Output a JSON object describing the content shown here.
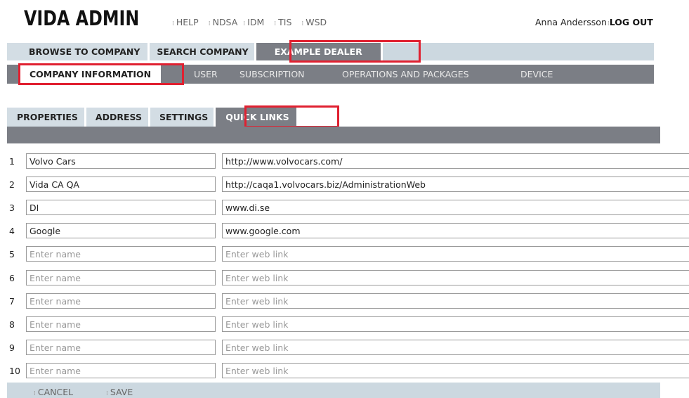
{
  "header": {
    "brand": "VIDA ADMIN",
    "links": [
      "HELP",
      "NDSA",
      "IDM",
      "TIS",
      "WSD"
    ],
    "user_name": "Anna Andersson",
    "logout": "LOG OUT"
  },
  "main_tabs": [
    "BROWSE TO COMPANY",
    "SEARCH COMPANY",
    "EXAMPLE DEALER"
  ],
  "sub_tabs": [
    "COMPANY INFORMATION",
    "USER",
    "SUBSCRIPTION",
    "OPERATIONS AND PACKAGES",
    "DEVICE"
  ],
  "inner_tabs": [
    "PROPERTIES",
    "ADDRESS",
    "SETTINGS",
    "QUICK LINKS"
  ],
  "rows": [
    {
      "num": "1",
      "name": "Volvo Cars",
      "link": "http://www.volvocars.com/"
    },
    {
      "num": "2",
      "name": "Vida CA QA",
      "link": "http://caqa1.volvocars.biz/AdministrationWeb"
    },
    {
      "num": "3",
      "name": "DI",
      "link": "www.di.se"
    },
    {
      "num": "4",
      "name": "Google",
      "link": "www.google.com"
    },
    {
      "num": "5",
      "name": "",
      "link": ""
    },
    {
      "num": "6",
      "name": "",
      "link": ""
    },
    {
      "num": "7",
      "name": "",
      "link": ""
    },
    {
      "num": "8",
      "name": "",
      "link": ""
    },
    {
      "num": "9",
      "name": "",
      "link": ""
    },
    {
      "num": "10",
      "name": "",
      "link": ""
    }
  ],
  "placeholders": {
    "name": "Enter name",
    "link": "Enter web link"
  },
  "footer": {
    "cancel": "CANCEL",
    "save": "SAVE"
  }
}
